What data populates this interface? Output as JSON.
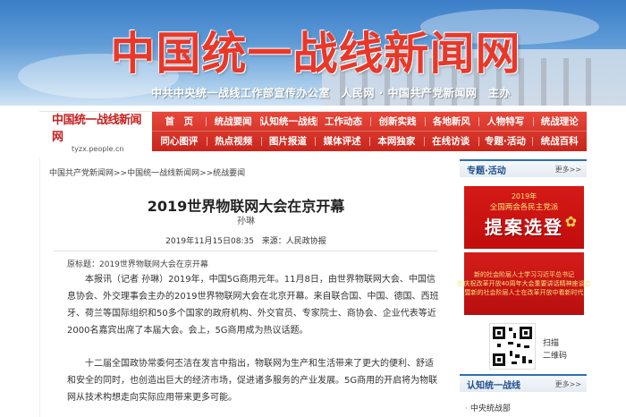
{
  "header": {
    "site_title": "中国统一战线新闻网",
    "sub_title": "中共中央统一战线工作部宣传办公室　人民网 · 中国共产党新闻网　主办"
  },
  "logo": {
    "name": "中国统一战线新闻网",
    "url": "tyzx.people.cn"
  },
  "nav": {
    "row1": [
      "首　页",
      "统战要闻",
      "认知统一战线",
      "工作动态",
      "创新实践",
      "各地新风",
      "人物特写",
      "统战理论"
    ],
    "row2": [
      "同心图评",
      "热点视频",
      "图片报道",
      "媒体评述",
      "本网独家",
      "在线访谈",
      "专题·活动",
      "统战百科"
    ]
  },
  "breadcrumb": "中国共产党新闻网>>中国统一战线新闻网>>统战要闻",
  "article": {
    "title": "2019世界物联网大会在京开幕",
    "author": "孙琳",
    "date": "2019年11月15日08:35",
    "source": "来源：人民政协报",
    "original_title": "原标题：2019世界物联网大会在京开幕",
    "para1": "本报讯（记者 孙琳）2019年，中国5G商用元年。11月8日，由世界物联网大会、中国信息协会、外交理事会主办的2019世界物联网大会在北京开幕。来自联合国、中国、德国、西班牙、荷兰等国际组织和50多个国家的政府机构、外交官员、专家院士、商协会、企业代表等近2000名嘉宾出席了本届大会。会上，5G商用成为热议话题。",
    "para2": "十二届全国政协常委何丕洁在发言中指出，物联网为生产和生活带来了更大的便利、舒适和安全的同时，也创造出巨大的经济市场，促进诸多服务的产业发展。5G商用的开启将为物联网从技术构想走向实际应用带来更多可能。"
  },
  "sidebar": {
    "section1_title": "专题·活动",
    "more": "更多>>",
    "promo": {
      "year": "2019年",
      "line1": "全国两会各民主党派",
      "big": "提案选登"
    },
    "notice_lines": [
      "新的社会阶层人士学习习近平总书记",
      "在庆祝改革开放40周年大会重要讲话精神座谈会",
      "暨新的社会阶层人士在改革开放中看新时代"
    ],
    "qr_label_1": "扫描",
    "qr_label_2": "二维码",
    "section2_title": "认知统一战线",
    "section2_more": "更多>>",
    "section2_item": "中央统战部"
  },
  "colors": {
    "title_red": "#e8382a",
    "nav_red": "#c8261d",
    "sidebar_blue": "#2d6fb4"
  }
}
